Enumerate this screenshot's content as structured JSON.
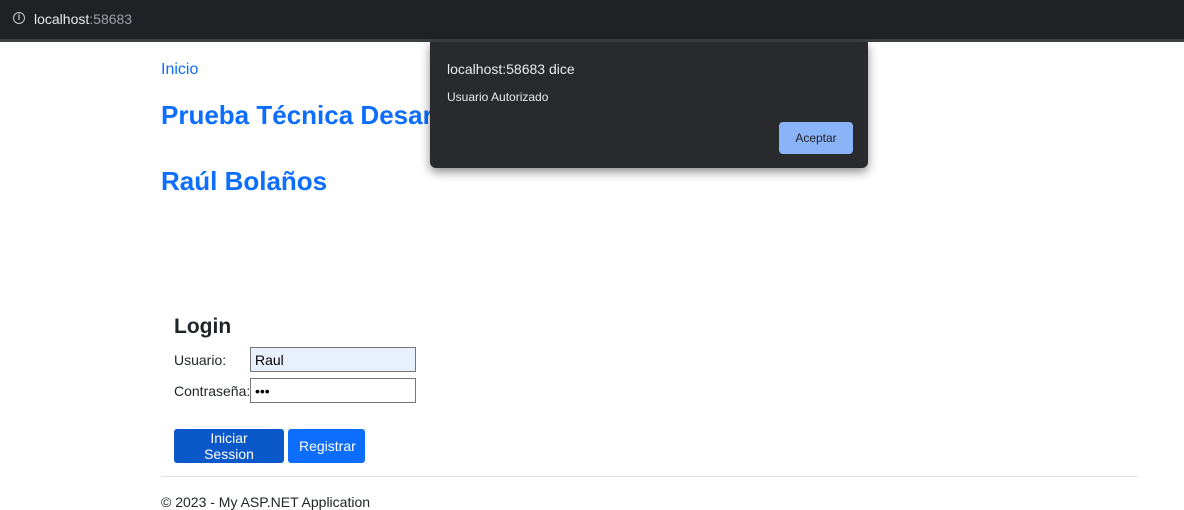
{
  "browser": {
    "host": "localhost",
    "port": ":58683"
  },
  "nav": {
    "home_link": "Inicio"
  },
  "header": {
    "title": "Prueba Técnica Desar",
    "author": "Raúl Bolaños"
  },
  "login": {
    "title": "Login",
    "user_label": "Usuario:",
    "user_value": "Raul",
    "password_label": "Contraseña:",
    "password_value": "•••",
    "login_button": "Iniciar Session",
    "register_button": "Registrar"
  },
  "footer": {
    "text": "© 2023 - My ASP.NET Application"
  },
  "dialog": {
    "title": "localhost:58683 dice",
    "message": "Usuario Autorizado",
    "ok_button": "Aceptar"
  }
}
